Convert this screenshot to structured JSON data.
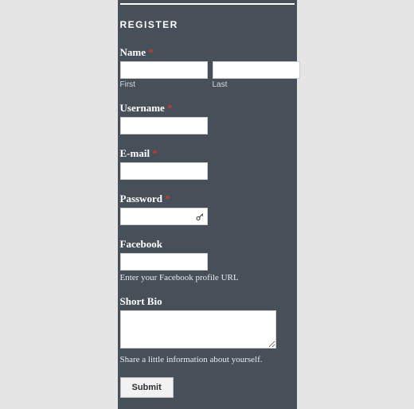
{
  "heading": "REGISTER",
  "name": {
    "label": "Name",
    "required": "*",
    "first_sub": "First",
    "last_sub": "Last",
    "first_value": "",
    "last_value": ""
  },
  "username": {
    "label": "Username",
    "required": "*",
    "value": ""
  },
  "email": {
    "label": "E-mail",
    "required": "*",
    "value": ""
  },
  "password": {
    "label": "Password",
    "required": "*",
    "value": ""
  },
  "facebook": {
    "label": "Facebook",
    "value": "",
    "help": "Enter your Facebook profile URL"
  },
  "bio": {
    "label": "Short Bio",
    "value": "",
    "help": "Share a little information about yourself."
  },
  "submit_label": "Submit"
}
